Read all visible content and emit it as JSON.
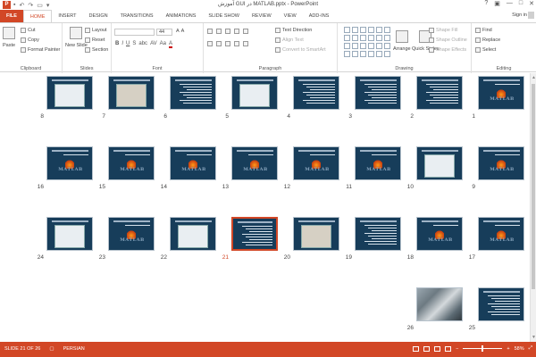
{
  "app": {
    "title": "آموزش GUI در MATLAB.pptx - PowerPoint",
    "icon_text": "P",
    "qat": [
      "save-icon",
      "undo-icon",
      "redo-icon",
      "start-from-beginning-icon",
      "customize-icon"
    ],
    "window_buttons": [
      "?",
      "▣",
      "—",
      "□",
      "✕"
    ],
    "sign_in": "Sign in"
  },
  "tabs": [
    "FILE",
    "HOME",
    "INSERT",
    "DESIGN",
    "TRANSITIONS",
    "ANIMATIONS",
    "SLIDE SHOW",
    "REVIEW",
    "VIEW",
    "ADD-INS"
  ],
  "active_tab": "HOME",
  "ribbon": {
    "clipboard": {
      "label": "Clipboard",
      "paste": "Paste",
      "cut": "Cut",
      "copy": "Copy",
      "format_painter": "Format Painter"
    },
    "slides": {
      "label": "Slides",
      "new_slide": "New Slide",
      "layout": "Layout",
      "reset": "Reset",
      "section": "Section"
    },
    "font": {
      "label": "Font",
      "font_name": "",
      "font_size": "44",
      "buttons": [
        "B",
        "I",
        "U",
        "S",
        "abc",
        "AV",
        "Aa",
        "A"
      ]
    },
    "paragraph": {
      "label": "Paragraph",
      "text_direction": "Text Direction",
      "align_text": "Align Text",
      "convert_smartart": "Convert to SmartArt"
    },
    "drawing": {
      "label": "Drawing",
      "arrange": "Arrange",
      "quick_styles": "Quick Styles",
      "shape_fill": "Shape Fill",
      "shape_outline": "Shape Outline",
      "shape_effects": "Shape Effects"
    },
    "editing": {
      "label": "Editing",
      "find": "Find",
      "replace": "Replace",
      "select": "Select"
    }
  },
  "slides": [
    {
      "num": "1",
      "kind": "logo"
    },
    {
      "num": "2",
      "kind": "text"
    },
    {
      "num": "3",
      "kind": "text"
    },
    {
      "num": "4",
      "kind": "text"
    },
    {
      "num": "5",
      "kind": "shot"
    },
    {
      "num": "6",
      "kind": "text"
    },
    {
      "num": "7",
      "kind": "shot-gray"
    },
    {
      "num": "8",
      "kind": "shot"
    },
    {
      "num": "9",
      "kind": "logo"
    },
    {
      "num": "10",
      "kind": "shot"
    },
    {
      "num": "11",
      "kind": "logo"
    },
    {
      "num": "12",
      "kind": "logo"
    },
    {
      "num": "13",
      "kind": "logo"
    },
    {
      "num": "14",
      "kind": "logo"
    },
    {
      "num": "15",
      "kind": "logo"
    },
    {
      "num": "16",
      "kind": "logo"
    },
    {
      "num": "17",
      "kind": "logo"
    },
    {
      "num": "18",
      "kind": "logo"
    },
    {
      "num": "19",
      "kind": "text"
    },
    {
      "num": "20",
      "kind": "shot-gray"
    },
    {
      "num": "21",
      "kind": "text"
    },
    {
      "num": "22",
      "kind": "shot"
    },
    {
      "num": "23",
      "kind": "logo"
    },
    {
      "num": "24",
      "kind": "shot"
    },
    {
      "num": "25",
      "kind": "text"
    },
    {
      "num": "26",
      "kind": "photo"
    }
  ],
  "selected_slide": "21",
  "status": {
    "slide_info": "SLIDE 21 OF 26",
    "language": "PERSIAN",
    "zoom": "58%",
    "zoom_fraction": 0.58,
    "view_icons": [
      "normal-view-icon",
      "slide-sorter-view-icon",
      "reading-view-icon",
      "slideshow-view-icon"
    ]
  },
  "colors": {
    "accent": "#d24726",
    "slide_bg": "#173d5a"
  }
}
